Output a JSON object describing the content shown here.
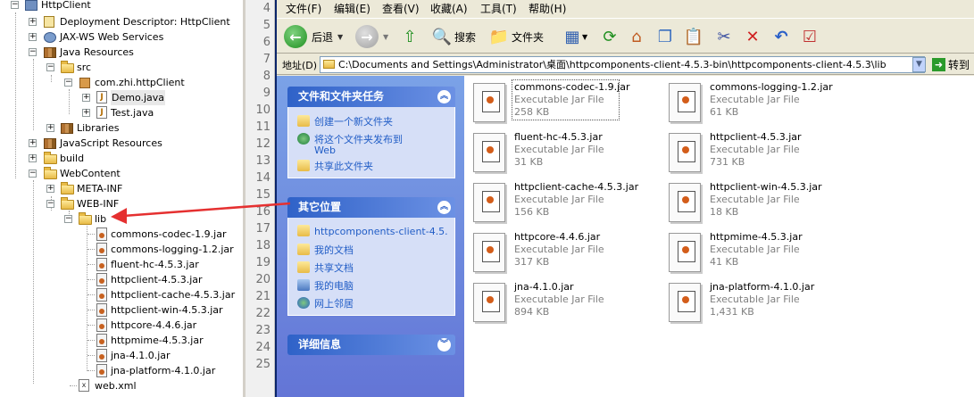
{
  "tree": {
    "project": "HttpClient",
    "items": [
      {
        "label": "Deployment Descriptor: HttpClient"
      },
      {
        "label": "JAX-WS Web Services"
      },
      {
        "label": "Java Resources"
      },
      {
        "label": "src"
      },
      {
        "label": "com.zhi.httpClient"
      },
      {
        "label": "Demo.java"
      },
      {
        "label": "Test.java"
      },
      {
        "label": "Libraries"
      },
      {
        "label": "JavaScript Resources"
      },
      {
        "label": "build"
      },
      {
        "label": "WebContent"
      },
      {
        "label": "META-INF"
      },
      {
        "label": "WEB-INF"
      },
      {
        "label": "lib"
      },
      {
        "label": "commons-codec-1.9.jar"
      },
      {
        "label": "commons-logging-1.2.jar"
      },
      {
        "label": "fluent-hc-4.5.3.jar"
      },
      {
        "label": "httpclient-4.5.3.jar"
      },
      {
        "label": "httpclient-cache-4.5.3.jar"
      },
      {
        "label": "httpclient-win-4.5.3.jar"
      },
      {
        "label": "httpcore-4.4.6.jar"
      },
      {
        "label": "httpmime-4.5.3.jar"
      },
      {
        "label": "jna-4.1.0.jar"
      },
      {
        "label": "jna-platform-4.1.0.jar"
      },
      {
        "label": "web.xml"
      }
    ]
  },
  "editor": {
    "line_numbers": [
      "4",
      "5",
      "6",
      "7",
      "8",
      "9",
      "10",
      "11",
      "12",
      "13",
      "14",
      "15",
      "16",
      "17",
      "18",
      "19",
      "20",
      "21",
      "22",
      "23",
      "24",
      "25"
    ]
  },
  "menu": [
    "文件(F)",
    "编辑(E)",
    "查看(V)",
    "收藏(A)",
    "工具(T)",
    "帮助(H)"
  ],
  "toolbar": {
    "back": "后退",
    "search": "搜索",
    "folders": "文件夹"
  },
  "address": {
    "label": "地址(D)",
    "path": "C:\\Documents and Settings\\Administrator\\桌面\\httpcomponents-client-4.5.3-bin\\httpcomponents-client-4.5.3\\lib",
    "go": "转到"
  },
  "taskpane": {
    "tasks_title": "文件和文件夹任务",
    "tasks": [
      "创建一个新文件夹",
      "将这个文件夹发布到",
      "Web",
      "共享此文件夹"
    ],
    "places_title": "其它位置",
    "places": [
      "httpcomponents-client-4.5.",
      "我的文档",
      "共享文档",
      "我的电脑",
      "网上邻居"
    ],
    "details_title": "详细信息"
  },
  "files": [
    {
      "name": "commons-codec-1.9.jar",
      "type": "Executable Jar File",
      "size": "258 KB"
    },
    {
      "name": "commons-logging-1.2.jar",
      "type": "Executable Jar File",
      "size": "61 KB"
    },
    {
      "name": "fluent-hc-4.5.3.jar",
      "type": "Executable Jar File",
      "size": "31 KB"
    },
    {
      "name": "httpclient-4.5.3.jar",
      "type": "Executable Jar File",
      "size": "731 KB"
    },
    {
      "name": "httpclient-cache-4.5.3.jar",
      "type": "Executable Jar File",
      "size": "156 KB"
    },
    {
      "name": "httpclient-win-4.5.3.jar",
      "type": "Executable Jar File",
      "size": "18 KB"
    },
    {
      "name": "httpcore-4.4.6.jar",
      "type": "Executable Jar File",
      "size": "317 KB"
    },
    {
      "name": "httpmime-4.5.3.jar",
      "type": "Executable Jar File",
      "size": "41 KB"
    },
    {
      "name": "jna-4.1.0.jar",
      "type": "Executable Jar File",
      "size": "894 KB"
    },
    {
      "name": "jna-platform-4.1.0.jar",
      "type": "Executable Jar File",
      "size": "1,431 KB"
    }
  ],
  "colors": {
    "arrow": "#e53030",
    "link": "#215dc6",
    "panel_header": "#2f62c8"
  }
}
